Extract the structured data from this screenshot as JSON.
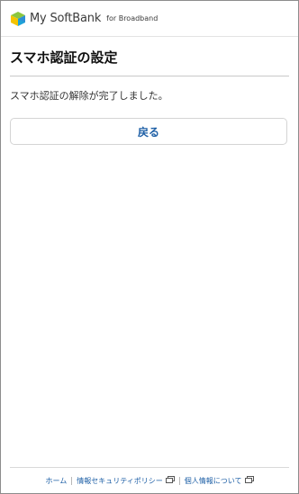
{
  "header": {
    "brand_main": "My SoftBank",
    "brand_sub": "for Broadband",
    "icon": "softbank-cube-logo"
  },
  "main": {
    "title": "スマホ認証の設定",
    "message": "スマホ認証の解除が完了しました。",
    "back_label": "戻る"
  },
  "footer": {
    "links": [
      {
        "label": "ホーム",
        "icon": ""
      },
      {
        "label": "情報セキュリティポリシー",
        "icon": "external-window-icon"
      },
      {
        "label": "個人情報について",
        "icon": "external-window-icon"
      }
    ]
  },
  "colors": {
    "accent": "#1d5fa6",
    "border": "#d4d4d4"
  }
}
